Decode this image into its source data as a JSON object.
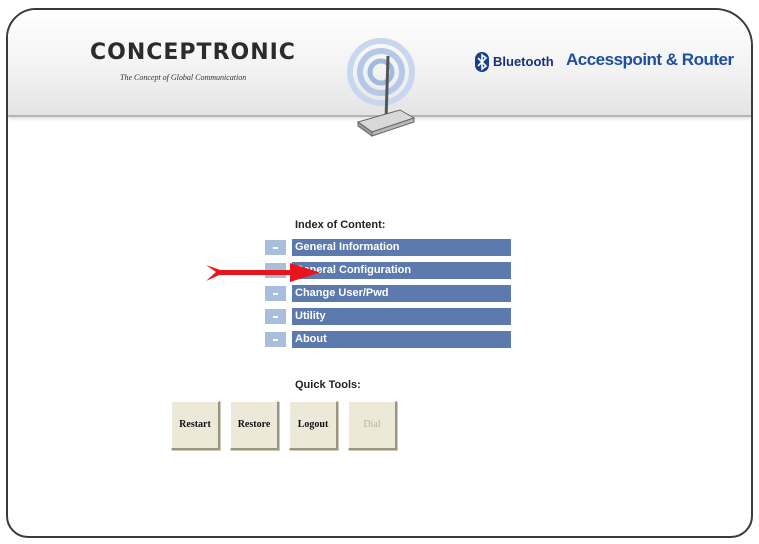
{
  "header": {
    "brand_name": "CONCEPTRONIC",
    "brand_tagline": "The Concept of Global Communication",
    "bluetooth_brand": "Bluetooth",
    "product_name": "Accesspoint & Router"
  },
  "index": {
    "title": "Index of Content:",
    "items": [
      {
        "label": "General Information"
      },
      {
        "label": "General Configuration"
      },
      {
        "label": "Change User/Pwd"
      },
      {
        "label": "Utility"
      },
      {
        "label": "About"
      }
    ]
  },
  "quick_tools": {
    "title": "Quick Tools:",
    "buttons": [
      {
        "label": "Restart"
      },
      {
        "label": "Restore"
      },
      {
        "label": "Logout"
      },
      {
        "label": "Dial"
      }
    ]
  },
  "colors": {
    "menu_bar": "#5c7aae",
    "menu_bullet": "#a9bedc",
    "arrow": "#e8161c",
    "brand_blue": "#1d4ea0"
  }
}
